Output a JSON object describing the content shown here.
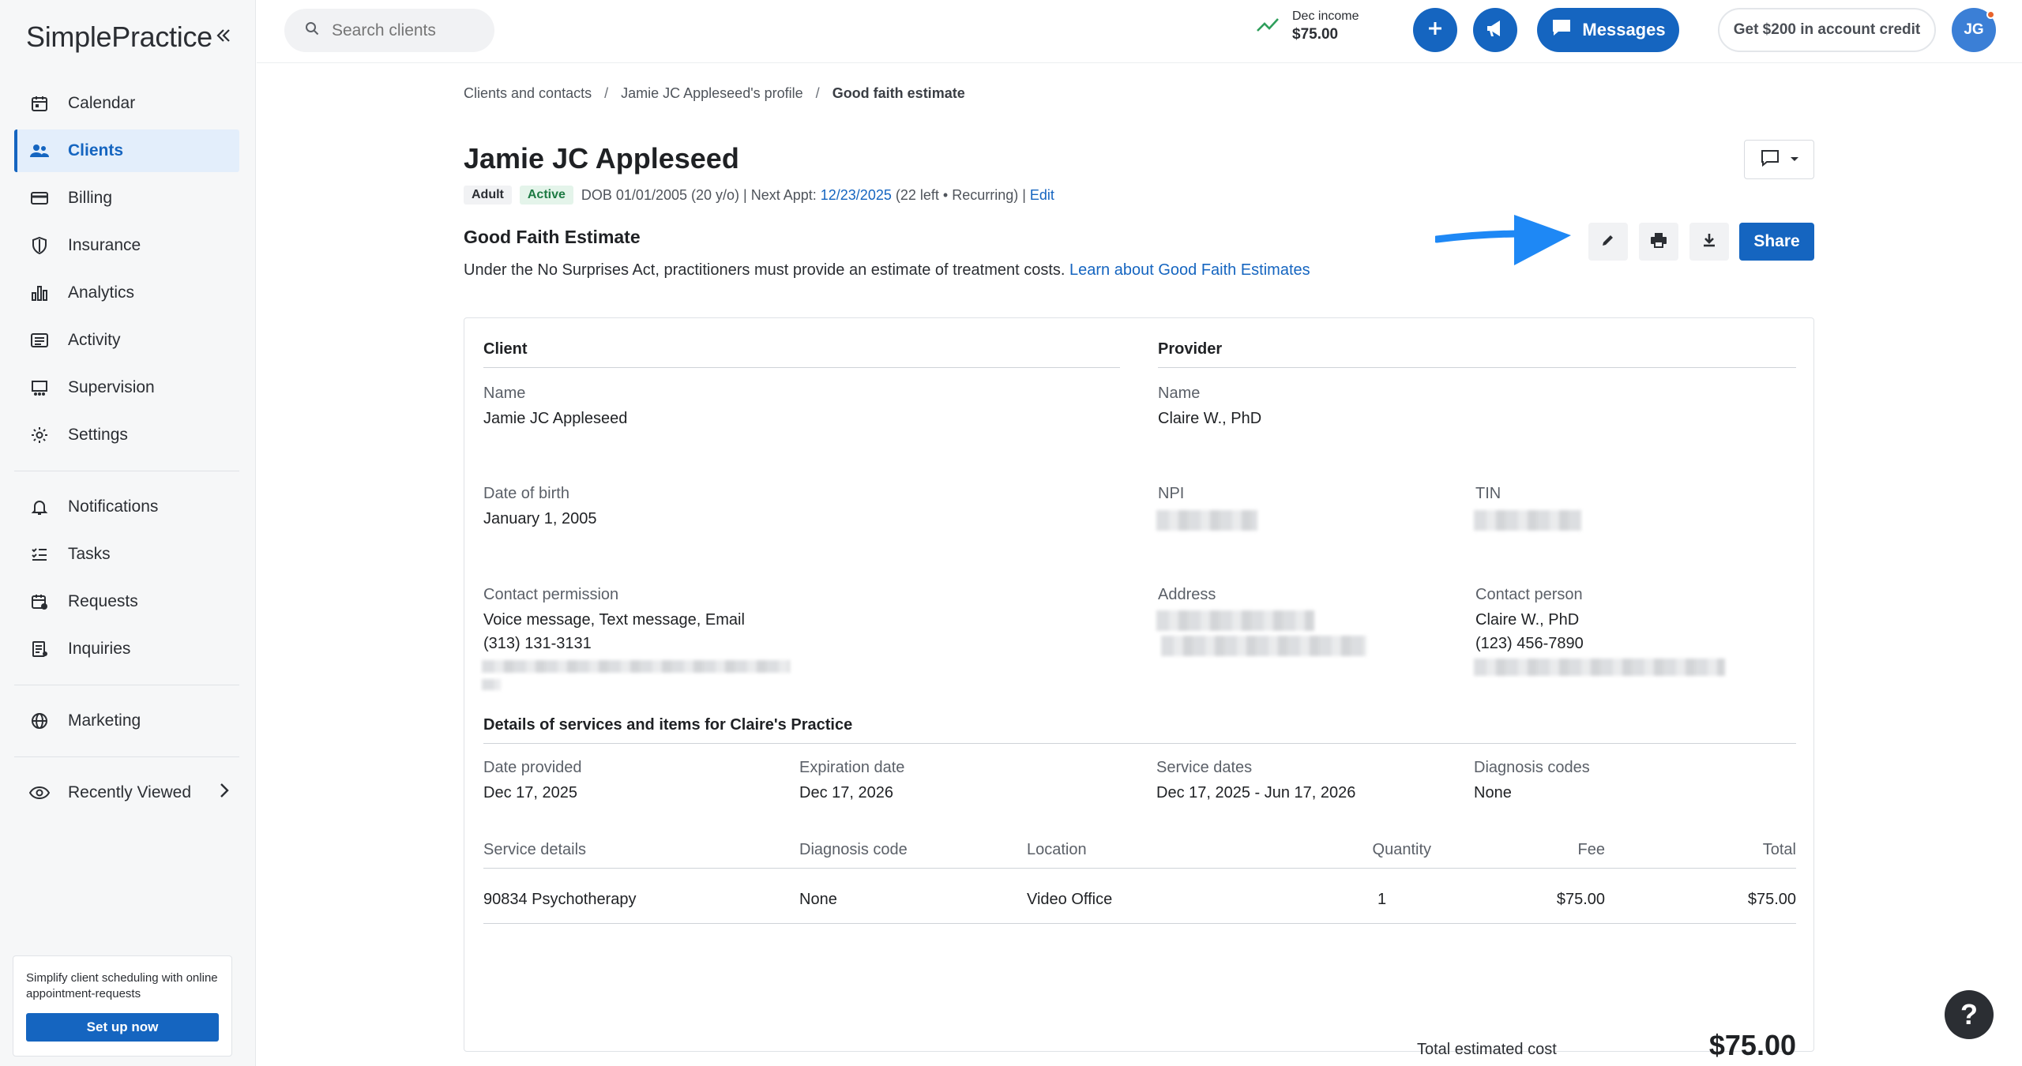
{
  "app": {
    "logo": "SimplePractice"
  },
  "sidebar": {
    "items": [
      {
        "label": "Calendar",
        "icon": "calendar-icon"
      },
      {
        "label": "Clients",
        "icon": "users-icon",
        "active": true
      },
      {
        "label": "Billing",
        "icon": "credit-card-icon"
      },
      {
        "label": "Insurance",
        "icon": "shield-icon"
      },
      {
        "label": "Analytics",
        "icon": "bar-chart-icon"
      },
      {
        "label": "Activity",
        "icon": "list-icon"
      },
      {
        "label": "Supervision",
        "icon": "supervision-icon"
      },
      {
        "label": "Settings",
        "icon": "gear-icon"
      }
    ],
    "items2": [
      {
        "label": "Notifications",
        "icon": "bell-icon"
      },
      {
        "label": "Tasks",
        "icon": "tasks-icon"
      },
      {
        "label": "Requests",
        "icon": "requests-icon"
      },
      {
        "label": "Inquiries",
        "icon": "inquiries-icon"
      }
    ],
    "marketing": "Marketing",
    "recently_viewed": "Recently Viewed",
    "promo": {
      "text": "Simplify client scheduling with online appointment-requests",
      "button": "Set up now"
    }
  },
  "topbar": {
    "search_placeholder": "Search clients",
    "income_label": "Dec income",
    "income_value": "$75.00",
    "messages": "Messages",
    "credit": "Get $200 in account credit",
    "avatar": "JG"
  },
  "breadcrumb": [
    "Clients and contacts",
    "Jamie JC Appleseed's profile",
    "Good faith estimate"
  ],
  "client": {
    "name": "Jamie JC Appleseed",
    "badge_adult": "Adult",
    "badge_active": "Active",
    "dob_text": "DOB 01/01/2005 (20 y/o) | Next Appt: ",
    "next_appt": "12/23/2025",
    "appt_extra": " (22 left • Recurring) | ",
    "edit": "Edit"
  },
  "gfe": {
    "title": "Good Faith Estimate",
    "subtitle": "Under the No Surprises Act, practitioners must provide an estimate of treatment costs. ",
    "learn_link": "Learn about Good Faith Estimates",
    "share": "Share"
  },
  "card": {
    "client_head": "Client",
    "provider_head": "Provider",
    "name_label": "Name",
    "client_name": "Jamie JC Appleseed",
    "provider_name": "Claire W., PhD",
    "dob_label": "Date of birth",
    "dob_value": "January 1, 2005",
    "npi_label": "NPI",
    "tin_label": "TIN",
    "contact_perm_label": "Contact permission",
    "contact_perm_value": "Voice message, Text message, Email",
    "client_phone": "(313) 131-3131",
    "address_label": "Address",
    "contact_person_label": "Contact person",
    "contact_person_name": "Claire W., PhD",
    "contact_person_phone": "(123) 456-7890",
    "details_head": "Details of services and items for Claire's Practice",
    "date_provided_label": "Date provided",
    "date_provided": "Dec 17, 2025",
    "expiration_label": "Expiration date",
    "expiration": "Dec 17, 2026",
    "service_dates_label": "Service dates",
    "service_dates": "Dec 17, 2025 - Jun 17, 2026",
    "diagnosis_codes_label": "Diagnosis codes",
    "diagnosis_codes": "None",
    "table": {
      "headers": [
        "Service details",
        "Diagnosis code",
        "Location",
        "Quantity",
        "Fee",
        "Total"
      ],
      "rows": [
        [
          "90834 Psychotherapy",
          "None",
          "Video Office",
          "1",
          "$75.00",
          "$75.00"
        ]
      ]
    },
    "total_label": "Total estimated cost",
    "total_value": "$75.00"
  },
  "help": "?"
}
